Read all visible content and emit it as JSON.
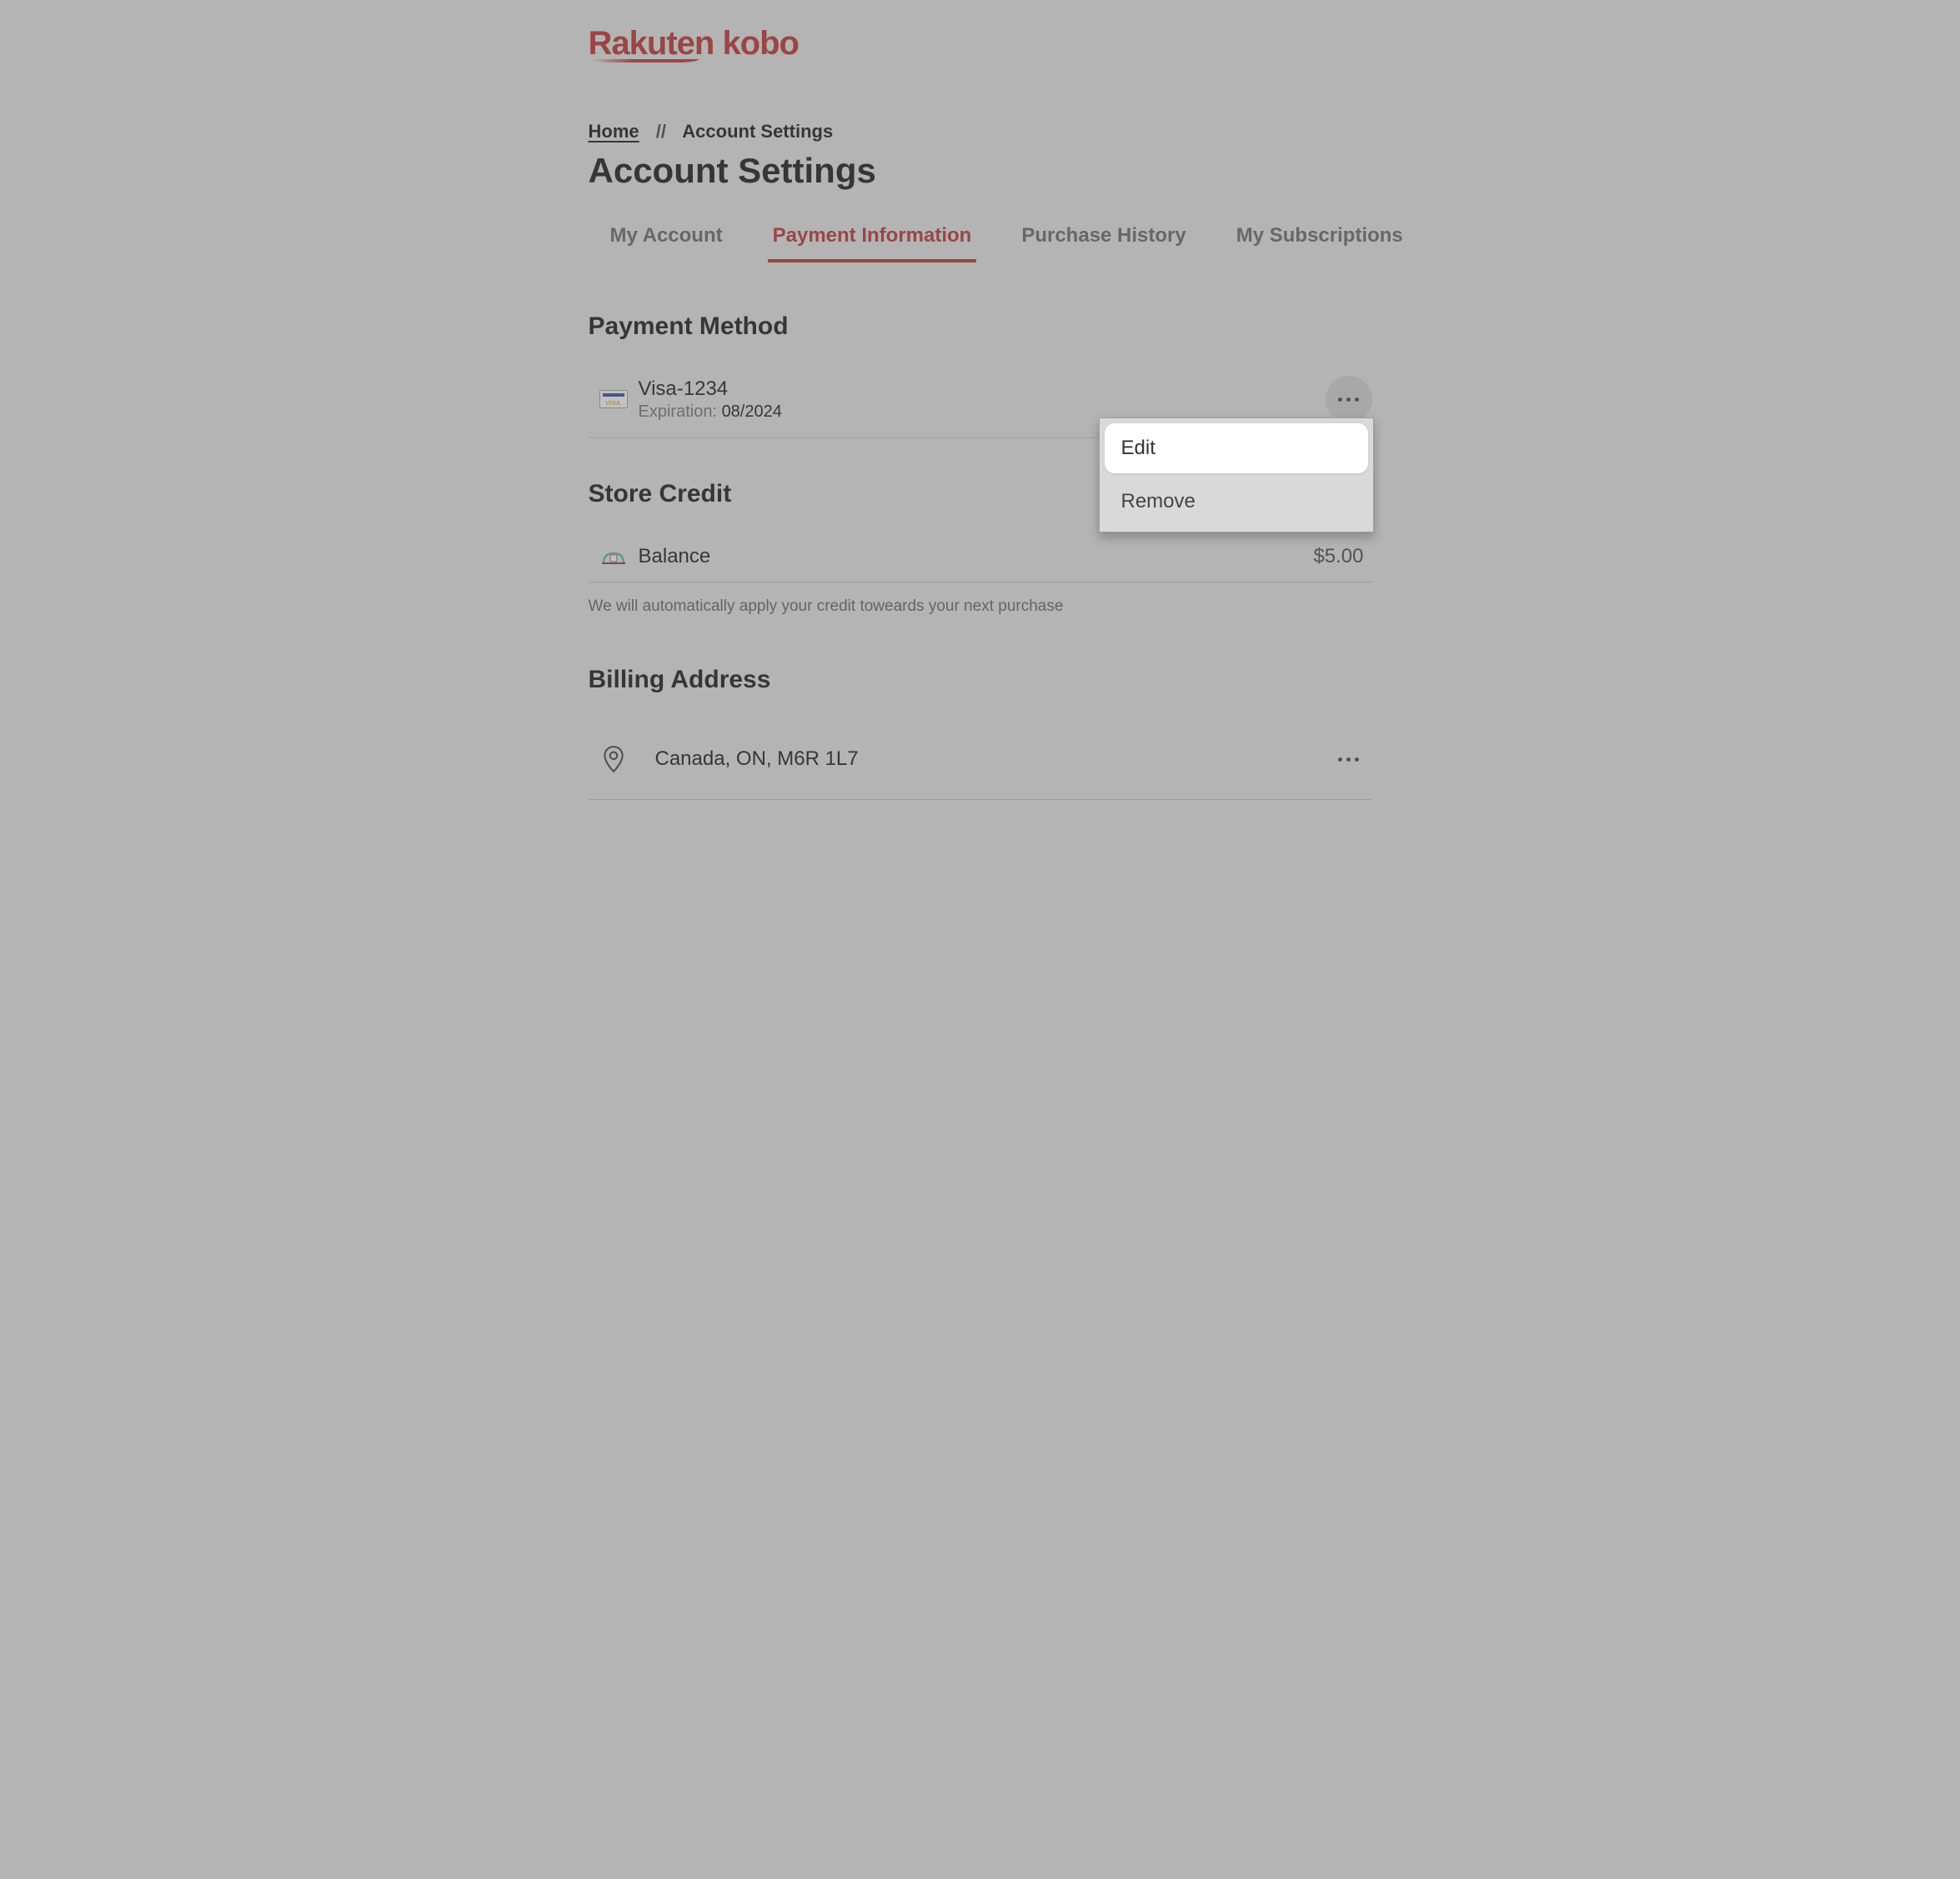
{
  "brand": {
    "name_part1": "Rakuten",
    "name_part2": "kobo"
  },
  "breadcrumb": {
    "home": "Home",
    "separator": "//",
    "current": "Account Settings"
  },
  "page_title": "Account Settings",
  "tabs": [
    {
      "label": "My Account",
      "active": false
    },
    {
      "label": "Payment Information",
      "active": true
    },
    {
      "label": "Purchase History",
      "active": false
    },
    {
      "label": "My Subscriptions",
      "active": false
    }
  ],
  "payment_method": {
    "heading": "Payment Method",
    "card_brand": "Visa",
    "card_last4": "1234",
    "expiration_label": "Expiration:",
    "expiration_value": "08/2024",
    "menu": {
      "edit": "Edit",
      "remove": "Remove"
    }
  },
  "store_credit": {
    "heading": "Store Credit",
    "balance_label": "Balance",
    "balance_amount": "$5.00",
    "note": "We will automatically apply your credit toweards your next purchase"
  },
  "billing": {
    "heading": "Billing Address",
    "address": "Canada, ON, M6R 1L7"
  }
}
